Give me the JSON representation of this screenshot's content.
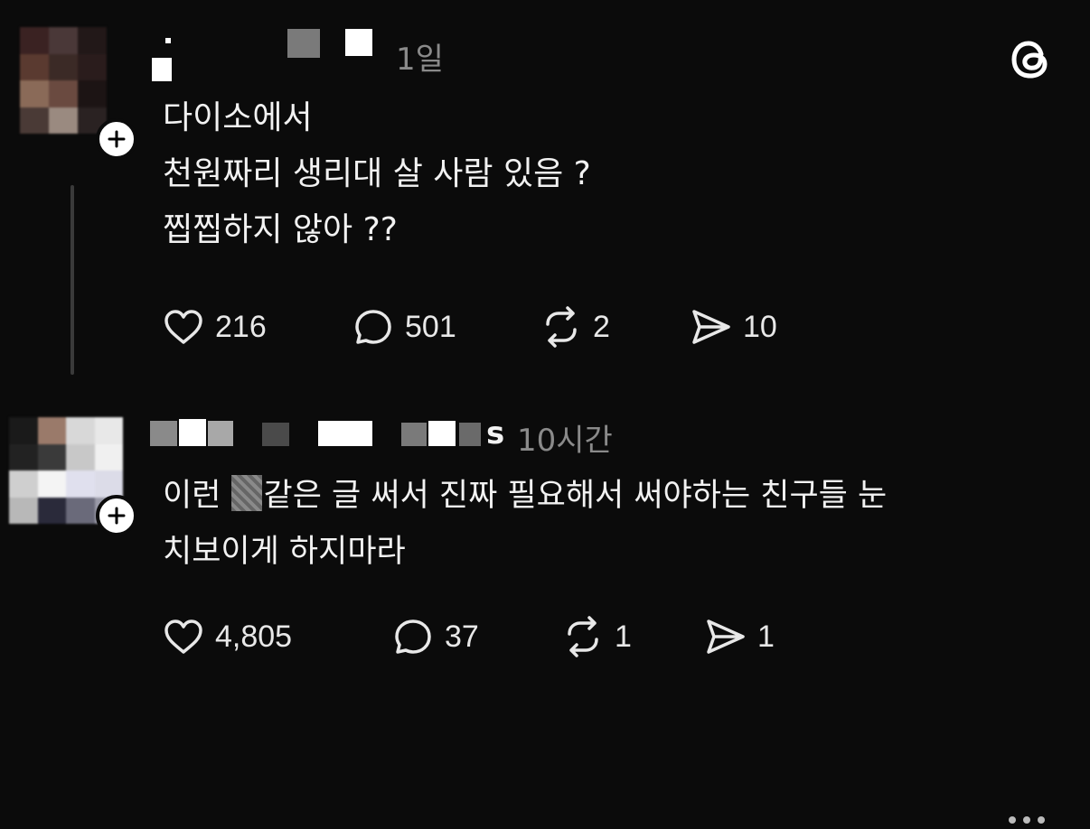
{
  "threads_logo": "threads-logo-icon",
  "posts": [
    {
      "time": "1일",
      "lines": [
        "다이소에서",
        "천원짜리 생리대 살 사람 있음 ?",
        "찝찝하지 않아 ??"
      ],
      "likes": "216",
      "replies": "501",
      "reposts": "2",
      "shares": "10"
    },
    {
      "username_tail": "s",
      "time": "10시간",
      "lines_prefix": "이런 ",
      "line1_rest": "같은 글 써서 진짜 필요해서 써야하는 친구들 눈",
      "line2": "치보이게 하지마라",
      "likes": "4,805",
      "replies": "37",
      "reposts": "1",
      "shares": "1"
    }
  ],
  "colors": {
    "background": "#0b0b0b",
    "text": "#f2f2f2",
    "muted": "#8a8a8a"
  }
}
